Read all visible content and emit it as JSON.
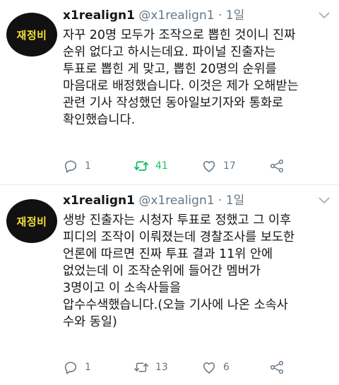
{
  "tweets": [
    {
      "avatar_text": "재정비",
      "name": "x1realign1",
      "handle": "@x1realign1",
      "separator": "·",
      "time": "1일",
      "text": "자꾸 20명 모두가 조작으로 뽑힌 것이니 진짜\n순위 없다고 하시는데요. 파이널 진출자는\n투표로 뽑힌 게 맞고, 뽑힌 20명의 순위를\n마음대로 배정했습니다. 이것은 제가 오해받는\n관련 기사 작성했던 동아일보기자와 통화로\n확인했습니다.",
      "replies": "1",
      "retweets": "41",
      "likes": "17",
      "retweeted": true
    },
    {
      "avatar_text": "재정비",
      "name": "x1realign1",
      "handle": "@x1realign1",
      "separator": "·",
      "time": "1일",
      "text": "생방 진출자는 시청자 투표로 정했고 그 이후\n피디의 조작이 이뤄졌는데 경찰조사를 보도한\n언론에 따르면 진짜 투표 결과 11위 안에\n없었는데 이 조작순위에 들어간 멤버가\n3명이고 이 소속사들을\n압수수색했습니다.(오늘 기사에 나온 소속사\n수와 동일)",
      "replies": "1",
      "retweets": "13",
      "likes": "6",
      "retweeted": false
    }
  ],
  "colors": {
    "text": "#14171a",
    "muted": "#657786",
    "retweet_active": "#17bf63",
    "avatar_bg": "#111111",
    "avatar_text": "#f2df3a"
  }
}
